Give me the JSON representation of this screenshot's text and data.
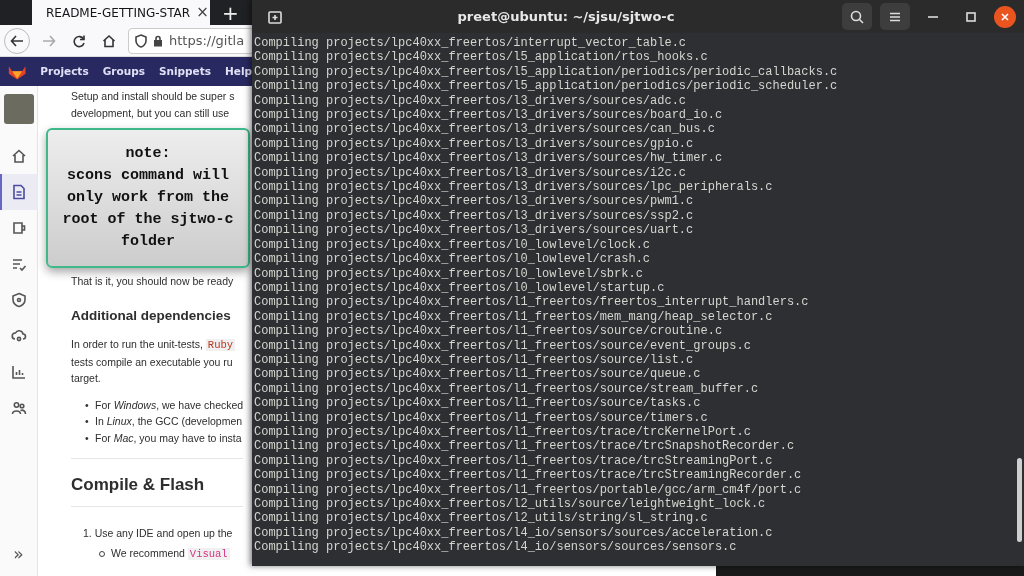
{
  "browser": {
    "tab": {
      "title": "README-GETTING-STAR",
      "close": "×",
      "selected": true
    },
    "new_tab": "+",
    "url": "https://gitla",
    "nav": [
      "Projects",
      "Groups",
      "Snippets",
      "Help"
    ],
    "sidebar": {
      "items": [
        {
          "selected": false
        },
        {
          "selected": true
        },
        {
          "selected": false
        },
        {
          "selected": false
        },
        {
          "selected": false
        },
        {
          "selected": false
        },
        {
          "selected": false
        },
        {
          "selected": false
        }
      ],
      "collapse": "»"
    },
    "content": {
      "intro": [
        "Setup and install should be super s",
        "development, but you can still use"
      ],
      "ready": "That is it, you should now be ready",
      "heading_1": "Additional dependencies",
      "para": {
        "lead": "In order to run the unit-tests, ",
        "code": "Ruby",
        "lines": [
          "tests compile an executable you ru",
          "target."
        ]
      },
      "bullet_marker": "•",
      "bullets": [
        "For *Windows*, we have checked",
        "In *Linux*, the GCC (developmen",
        "For *Mac*, you may have to insta"
      ],
      "heading_2": "Compile & Flash",
      "step": {
        "number": "1.",
        "text": "Use any IDE and open up the"
      },
      "sub_step": {
        "text": "We recommend ",
        "code": "Visual"
      }
    }
  },
  "note": {
    "title": "note:",
    "lines": [
      "scons command will",
      "only work from the",
      "root of the sjtwo-c",
      "folder"
    ]
  },
  "terminal": {
    "title": "preet@ubuntu: ~/sjsu/sjtwo-c",
    "lines": [
      "Compiling projects/lpc40xx_freertos/interrupt_vector_table.c",
      "Compiling projects/lpc40xx_freertos/l5_application/rtos_hooks.c",
      "Compiling projects/lpc40xx_freertos/l5_application/periodics/periodic_callbacks.c",
      "Compiling projects/lpc40xx_freertos/l5_application/periodics/periodic_scheduler.c",
      "Compiling projects/lpc40xx_freertos/l3_drivers/sources/adc.c",
      "Compiling projects/lpc40xx_freertos/l3_drivers/sources/board_io.c",
      "Compiling projects/lpc40xx_freertos/l3_drivers/sources/can_bus.c",
      "Compiling projects/lpc40xx_freertos/l3_drivers/sources/gpio.c",
      "Compiling projects/lpc40xx_freertos/l3_drivers/sources/hw_timer.c",
      "Compiling projects/lpc40xx_freertos/l3_drivers/sources/i2c.c",
      "Compiling projects/lpc40xx_freertos/l3_drivers/sources/lpc_peripherals.c",
      "Compiling projects/lpc40xx_freertos/l3_drivers/sources/pwm1.c",
      "Compiling projects/lpc40xx_freertos/l3_drivers/sources/ssp2.c",
      "Compiling projects/lpc40xx_freertos/l3_drivers/sources/uart.c",
      "Compiling projects/lpc40xx_freertos/l0_lowlevel/clock.c",
      "Compiling projects/lpc40xx_freertos/l0_lowlevel/crash.c",
      "Compiling projects/lpc40xx_freertos/l0_lowlevel/sbrk.c",
      "Compiling projects/lpc40xx_freertos/l0_lowlevel/startup.c",
      "Compiling projects/lpc40xx_freertos/l1_freertos/freertos_interrupt_handlers.c",
      "Compiling projects/lpc40xx_freertos/l1_freertos/mem_mang/heap_selector.c",
      "Compiling projects/lpc40xx_freertos/l1_freertos/source/croutine.c",
      "Compiling projects/lpc40xx_freertos/l1_freertos/source/event_groups.c",
      "Compiling projects/lpc40xx_freertos/l1_freertos/source/list.c",
      "Compiling projects/lpc40xx_freertos/l1_freertos/source/queue.c",
      "Compiling projects/lpc40xx_freertos/l1_freertos/source/stream_buffer.c",
      "Compiling projects/lpc40xx_freertos/l1_freertos/source/tasks.c",
      "Compiling projects/lpc40xx_freertos/l1_freertos/source/timers.c",
      "Compiling projects/lpc40xx_freertos/l1_freertos/trace/trcKernelPort.c",
      "Compiling projects/lpc40xx_freertos/l1_freertos/trace/trcSnapshotRecorder.c",
      "Compiling projects/lpc40xx_freertos/l1_freertos/trace/trcStreamingPort.c",
      "Compiling projects/lpc40xx_freertos/l1_freertos/trace/trcStreamingRecorder.c",
      "Compiling projects/lpc40xx_freertos/l1_freertos/portable/gcc/arm_cm4f/port.c",
      "Compiling projects/lpc40xx_freertos/l2_utils/source/leightweight_lock.c",
      "Compiling projects/lpc40xx_freertos/l2_utils/string/sl_string.c",
      "Compiling projects/lpc40xx_freertos/l4_io/sensors/sources/acceleration.c",
      "Compiling projects/lpc40xx_freertos/l4_io/sensors/sources/sensors.c"
    ]
  }
}
